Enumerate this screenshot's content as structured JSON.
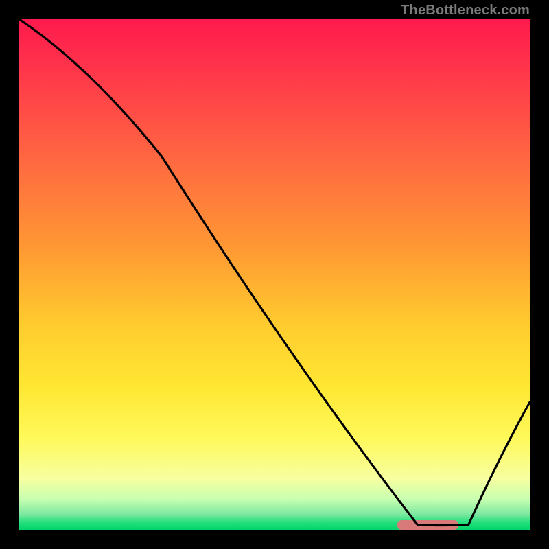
{
  "watermark": "TheBottleneck.com",
  "chart_data": {
    "type": "line",
    "title": "",
    "xlabel": "",
    "ylabel": "",
    "xlim": [
      0,
      100
    ],
    "ylim": [
      0,
      100
    ],
    "x": [
      0,
      28,
      78,
      88,
      100
    ],
    "y": [
      100,
      73,
      1,
      1,
      25
    ],
    "marker": {
      "x_range": [
        74,
        86
      ],
      "y": 1,
      "color": "#d87a7a"
    },
    "background_gradient_top": "#ff1a4d",
    "background_gradient_bottom": "#00d46a",
    "line_color": "#000000"
  }
}
